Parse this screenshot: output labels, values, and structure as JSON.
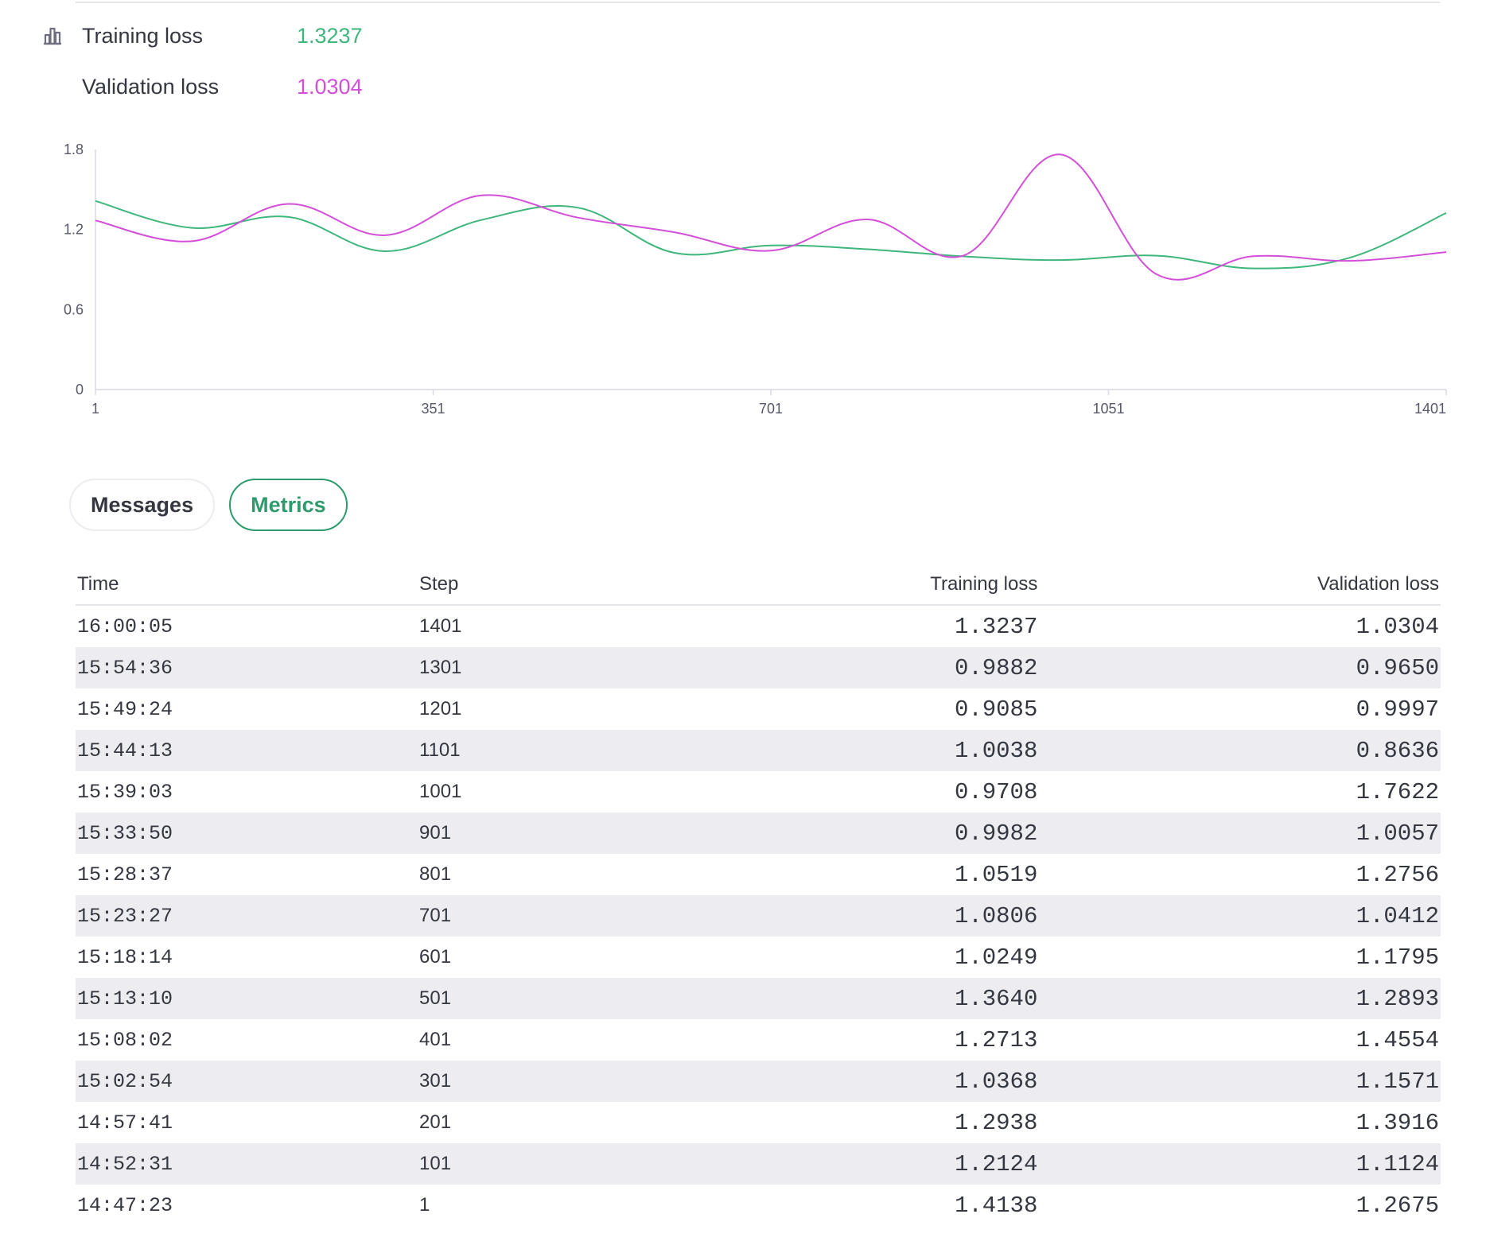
{
  "summary": {
    "training_label": "Training loss",
    "training_value": "1.3237",
    "validation_label": "Validation loss",
    "validation_value": "1.0304",
    "icon": "bar-chart-icon"
  },
  "colors": {
    "training": "#3fb67b",
    "validation": "#d34fd8",
    "accent": "#2e9b6c"
  },
  "chart_data": {
    "type": "line",
    "x": [
      1,
      101,
      201,
      301,
      401,
      501,
      601,
      701,
      801,
      901,
      1001,
      1101,
      1201,
      1301,
      1401
    ],
    "series": [
      {
        "name": "Training loss",
        "values": [
          1.4138,
          1.2124,
          1.2938,
          1.0368,
          1.2713,
          1.364,
          1.0249,
          1.0806,
          1.0519,
          0.9982,
          0.9708,
          1.0038,
          0.9085,
          0.9882,
          1.3237
        ]
      },
      {
        "name": "Validation loss",
        "values": [
          1.2675,
          1.1124,
          1.3916,
          1.1571,
          1.4554,
          1.2893,
          1.1795,
          1.0412,
          1.2756,
          1.0057,
          1.7622,
          0.8636,
          0.9997,
          0.965,
          1.0304
        ]
      }
    ],
    "ylim": [
      0,
      1.8
    ],
    "yticks": [
      "0",
      "0.6",
      "1.2",
      "1.8"
    ],
    "xticks": [
      "1",
      "351",
      "701",
      "1051",
      "1401"
    ],
    "xtick_values": [
      1,
      351,
      701,
      1051,
      1401
    ],
    "ytick_values": [
      0,
      0.6,
      1.2,
      1.8
    ],
    "xlabel": "",
    "ylabel": "",
    "grid": false,
    "legend": "none"
  },
  "tabs": [
    {
      "label": "Messages",
      "active": false
    },
    {
      "label": "Metrics",
      "active": true
    }
  ],
  "table": {
    "headers": {
      "time": "Time",
      "step": "Step",
      "training": "Training loss",
      "validation": "Validation loss"
    },
    "rows": [
      {
        "time": "16:00:05",
        "step": "1401",
        "training": "1.3237",
        "validation": "1.0304"
      },
      {
        "time": "15:54:36",
        "step": "1301",
        "training": "0.9882",
        "validation": "0.9650"
      },
      {
        "time": "15:49:24",
        "step": "1201",
        "training": "0.9085",
        "validation": "0.9997"
      },
      {
        "time": "15:44:13",
        "step": "1101",
        "training": "1.0038",
        "validation": "0.8636"
      },
      {
        "time": "15:39:03",
        "step": "1001",
        "training": "0.9708",
        "validation": "1.7622"
      },
      {
        "time": "15:33:50",
        "step": "901",
        "training": "0.9982",
        "validation": "1.0057"
      },
      {
        "time": "15:28:37",
        "step": "801",
        "training": "1.0519",
        "validation": "1.2756"
      },
      {
        "time": "15:23:27",
        "step": "701",
        "training": "1.0806",
        "validation": "1.0412"
      },
      {
        "time": "15:18:14",
        "step": "601",
        "training": "1.0249",
        "validation": "1.1795"
      },
      {
        "time": "15:13:10",
        "step": "501",
        "training": "1.3640",
        "validation": "1.2893"
      },
      {
        "time": "15:08:02",
        "step": "401",
        "training": "1.2713",
        "validation": "1.4554"
      },
      {
        "time": "15:02:54",
        "step": "301",
        "training": "1.0368",
        "validation": "1.1571"
      },
      {
        "time": "14:57:41",
        "step": "201",
        "training": "1.2938",
        "validation": "1.3916"
      },
      {
        "time": "14:52:31",
        "step": "101",
        "training": "1.2124",
        "validation": "1.1124"
      },
      {
        "time": "14:47:23",
        "step": "1",
        "training": "1.4138",
        "validation": "1.2675"
      }
    ]
  }
}
